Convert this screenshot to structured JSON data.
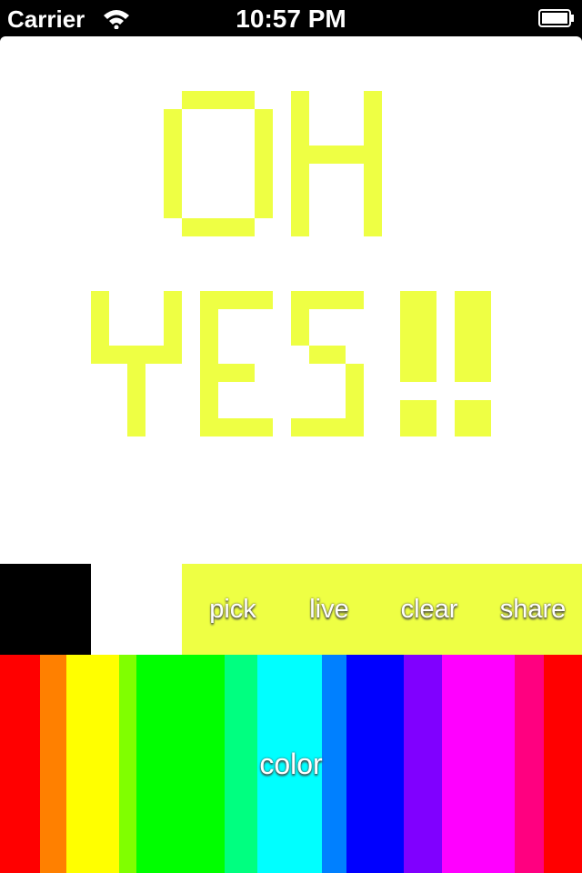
{
  "status_bar": {
    "carrier": "Carrier",
    "time": "10:57 PM",
    "wifi_icon": "wifi-icon",
    "battery_icon": "battery-icon"
  },
  "canvas": {
    "background": "#ffffff",
    "paint_color": "#eeff44",
    "drawing_text_line1": "OH",
    "drawing_text_line2": "YES!!"
  },
  "toolbar": {
    "swatch_primary": "#000000",
    "swatch_secondary": "#ffffff",
    "actions_background": "#eeff44",
    "pick_label": "pick",
    "live_label": "live",
    "clear_label": "clear",
    "share_label": "share"
  },
  "palette": {
    "label": "color",
    "colors": [
      "#ff0000",
      "#ff8000",
      "#ffff00",
      "#80ff00",
      "#00ff00",
      "#00ff80",
      "#00ffff",
      "#0080ff",
      "#0000ff",
      "#8000ff",
      "#ff00ff",
      "#ff0080",
      "#ff0000"
    ]
  }
}
